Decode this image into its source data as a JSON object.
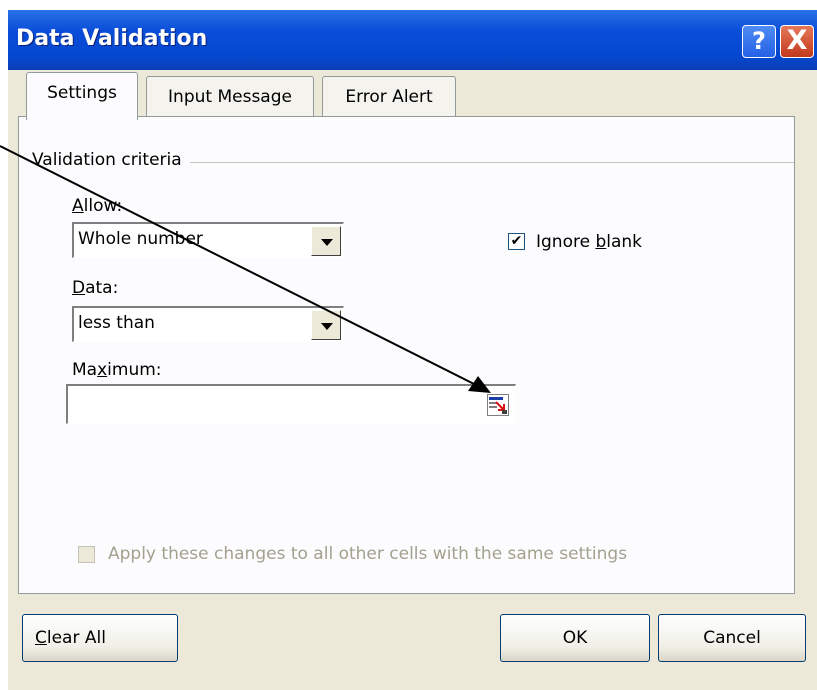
{
  "window": {
    "title": "Data Validation",
    "help_glyph": "?",
    "close_glyph": "X"
  },
  "tabs": [
    {
      "label": "Settings",
      "active": true
    },
    {
      "label": "Input Message",
      "active": false
    },
    {
      "label": "Error Alert",
      "active": false
    }
  ],
  "settings": {
    "group_label": "Validation criteria",
    "allow": {
      "label_pre": "",
      "label_accel": "A",
      "label_post": "llow:",
      "value": "Whole number"
    },
    "data": {
      "label_pre": "",
      "label_accel": "D",
      "label_post": "ata:",
      "value": "less than"
    },
    "maximum": {
      "label_pre": "Ma",
      "label_accel": "x",
      "label_post": "imum:",
      "value": ""
    },
    "ignore_blank": {
      "checked": true,
      "label_pre": "Ignore ",
      "label_accel": "b",
      "label_post": "lank"
    },
    "apply_all": {
      "checked": false,
      "enabled": false,
      "label": "Apply these changes to all other cells with the same settings"
    }
  },
  "buttons": {
    "clear_all": {
      "accel": "C",
      "rest": "lear All"
    },
    "ok": "OK",
    "cancel": "Cancel"
  },
  "icons": {
    "help": "help-icon",
    "close": "close-icon",
    "dropdown": "chevron-down-icon",
    "ref": "range-select-icon",
    "check": "checkmark-icon"
  }
}
